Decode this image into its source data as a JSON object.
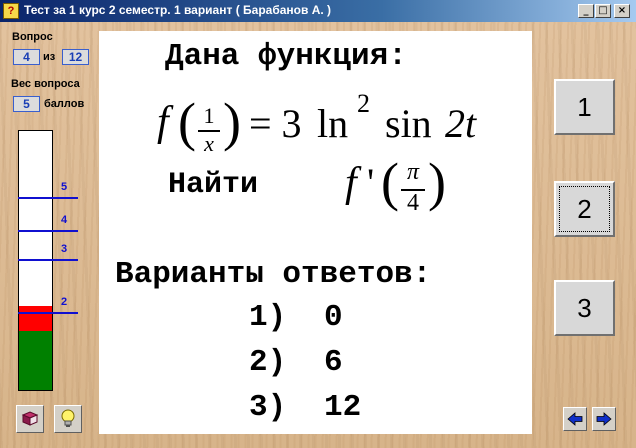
{
  "window": {
    "title": "Тест за 1 курс 2 семестр. 1 вариант  ( Барабанов А. )",
    "app_icon_text": "?",
    "minimize_glyph": "_",
    "maximize_glyph": "□",
    "close_glyph": "×"
  },
  "sidebar": {
    "question_label": "Вопрос",
    "question_current": "4",
    "question_of": "из",
    "question_total": "12",
    "weight_label": "Вес вопроса",
    "weight_value": "5",
    "weight_unit": "баллов",
    "gauge_labels": [
      "5",
      "4",
      "3",
      "2"
    ],
    "gauge_colors": {
      "fill_green": "#008000",
      "fill_red": "#ff0000",
      "lines": "#1010d0"
    }
  },
  "question": {
    "heading": "Дана функция:",
    "formula": {
      "f": "f",
      "frac_num": "1",
      "frac_den": "x",
      "rhs_coef": "= 3",
      "ln": "ln",
      "ln_power": "2",
      "sin": "sin",
      "sin_arg": "2t"
    },
    "find_label": "Найти",
    "find_expr": {
      "f": "f",
      "prime": "'",
      "frac_num": "π",
      "frac_den": "4"
    },
    "answers_heading": "Варианты ответов:",
    "answers": [
      {
        "num": "1)",
        "value": "0"
      },
      {
        "num": "2)",
        "value": "6"
      },
      {
        "num": "3)",
        "value": "12"
      }
    ]
  },
  "answer_buttons": [
    "1",
    "2",
    "3"
  ],
  "nav": {
    "prev_icon": "arrow-left-icon",
    "next_icon": "arrow-right-icon"
  },
  "colors": {
    "titlebar": "#0a246a",
    "accent_blue": "#1a3fb5",
    "panel_bg": "#ffffff"
  }
}
